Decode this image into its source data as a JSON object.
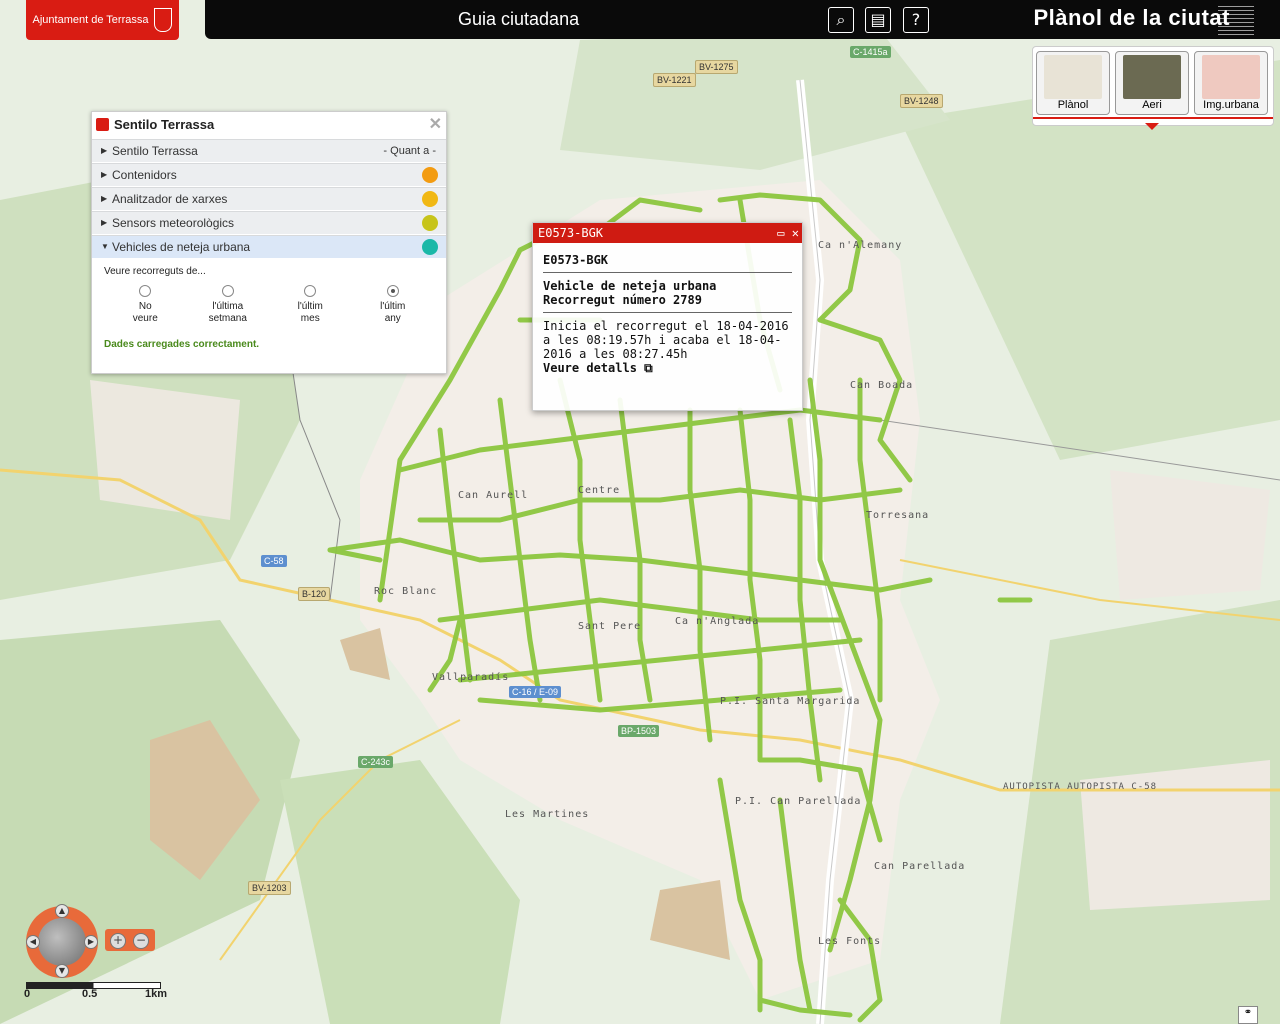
{
  "header": {
    "logo_text": "Ajuntament de Terrassa",
    "title": "Guia ciutadana",
    "brand": "Plànol de la ciutat"
  },
  "layers": [
    {
      "label": "Plànol"
    },
    {
      "label": "Aeri"
    },
    {
      "label": "Img.urbana"
    }
  ],
  "panel": {
    "title": "Sentilo Terrassa",
    "rows": [
      {
        "label": "Sentilo Terrassa",
        "right": "- Quant a -"
      },
      {
        "label": "Contenidors",
        "color": "#f39c12"
      },
      {
        "label": "Analitzador de xarxes",
        "color": "#f1b814"
      },
      {
        "label": "Sensors meteorològics",
        "color": "#c7c41a"
      },
      {
        "label": "Vehicles de neteja urbana",
        "color": "#1ab8a8"
      }
    ],
    "prompt": "Veure recorreguts de...",
    "options": [
      {
        "line1": "No",
        "line2": "veure",
        "selected": false
      },
      {
        "line1": "l'última",
        "line2": "setmana",
        "selected": false
      },
      {
        "line1": "l'últim",
        "line2": "mes",
        "selected": false
      },
      {
        "line1": "l'últim",
        "line2": "any",
        "selected": true
      }
    ],
    "status": "Dades carregades correctament."
  },
  "popup": {
    "header": "E0573-BGK",
    "title": "E0573-BGK",
    "type": "Vehicle de neteja urbana",
    "route": "Recorregut número 2789",
    "description": "Inicia el recorregut el 18-04-2016 a les 08:19.57h i acaba el 18-04-2016 a les 08:27.45h",
    "details": "Veure detalls"
  },
  "map_labels": [
    "Can Aurell",
    "Centre",
    "Roc Blanc",
    "Sant Pere",
    "Ca n'Anglada",
    "Vallparadís",
    "P.I. Santa Margarida",
    "P.I. Can Parellada",
    "Can Parellada",
    "Torresana",
    "Les Martines",
    "Les Fonts",
    "Can Boada",
    "Ca n'Alemany"
  ],
  "road_labels": [
    "BV-1221",
    "BV-1275",
    "C-1415a",
    "BV-1248",
    "C-58",
    "B-120",
    "C-16 / E-09",
    "BP-1503",
    "C-243c",
    "BV-1203",
    "AUTOPISTA AUTOPISTA C-58"
  ],
  "scale": {
    "labels": [
      "0",
      "0.5",
      "1km"
    ]
  },
  "colors": {
    "accent": "#d91c13",
    "route": "#8cc63f",
    "header_bg": "#0a0a0a"
  }
}
